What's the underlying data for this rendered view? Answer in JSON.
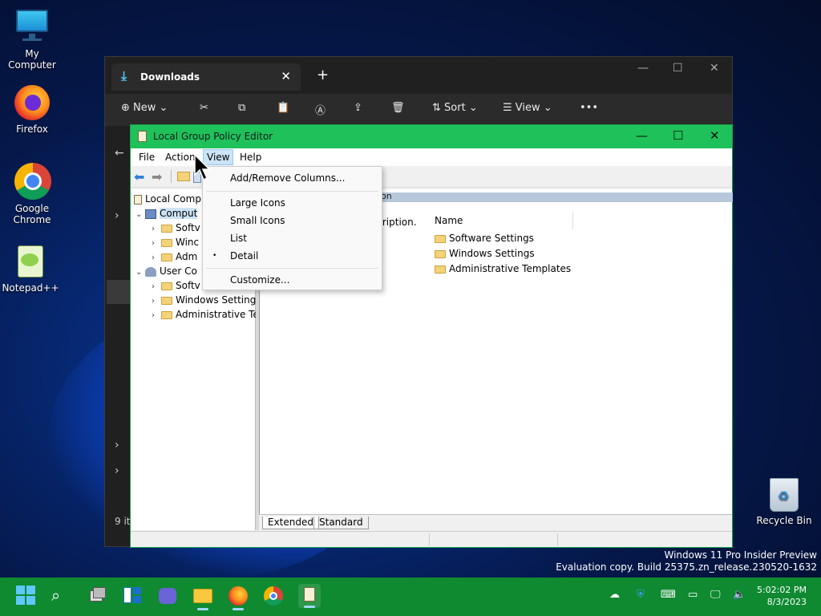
{
  "desktop": {
    "icons": [
      {
        "label": "My Computer"
      },
      {
        "label": "Firefox"
      },
      {
        "label": "Google Chrome"
      },
      {
        "label": "Notepad++"
      }
    ],
    "recycle_label": "Recycle Bin"
  },
  "explorer": {
    "tab_title": "Downloads",
    "tab_close": "✕",
    "new_tab": "+",
    "min": "—",
    "max": "☐",
    "close": "✕",
    "toolbar": {
      "new_label": "New",
      "sort_label": "Sort",
      "view_label": "View",
      "more_label": "•••"
    },
    "status_fragment": "9 it"
  },
  "gpedit": {
    "title": "Local Group Policy Editor",
    "menu": {
      "file": "File",
      "action": "Action",
      "view": "View",
      "help": "Help"
    },
    "tree": [
      {
        "label": "Local Comp"
      },
      {
        "label": "Comput"
      },
      {
        "label": "Softv"
      },
      {
        "label": "Winc"
      },
      {
        "label": "Adm"
      },
      {
        "label": "User Co"
      },
      {
        "label": "Softv"
      },
      {
        "label": "Windows Setting"
      },
      {
        "label": "Administrative Te"
      }
    ],
    "header_fragment": "on",
    "description_fragment": "scription.",
    "columns": {
      "name": "Name"
    },
    "items": [
      {
        "label": "Software Settings"
      },
      {
        "label": "Windows Settings"
      },
      {
        "label": "Administrative Templates"
      }
    ],
    "tabs": {
      "extended": "Extended",
      "standard": "Standard"
    }
  },
  "view_menu": {
    "items": [
      {
        "label": "Add/Remove Columns..."
      },
      {
        "label": "Large Icons"
      },
      {
        "label": "Small Icons"
      },
      {
        "label": "List"
      },
      {
        "label": "Detail",
        "checked": true
      },
      {
        "label": "Customize..."
      }
    ],
    "bullet": "•"
  },
  "watermark": {
    "line1": "Windows 11 Pro Insider Preview",
    "line2": "Evaluation copy. Build 25375.zn_release.230520-1632"
  },
  "taskbar": {
    "time": "5:02:02 PM",
    "date": "8/3/2023",
    "accent": "#0f8a31"
  }
}
